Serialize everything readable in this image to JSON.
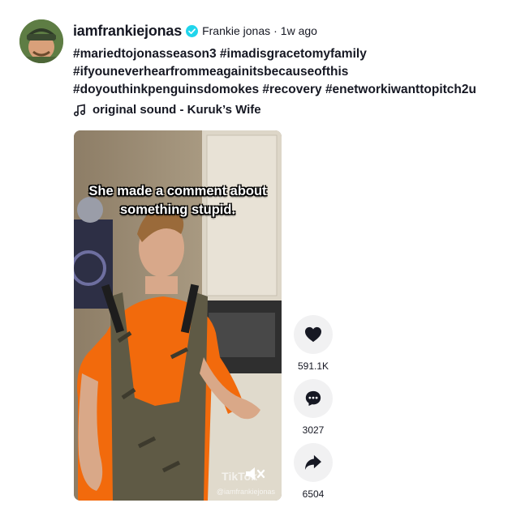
{
  "post": {
    "username": "iamfrankiejonas",
    "nickname": "Frankie jonas",
    "separator": "·",
    "time": "1w ago",
    "hashtags": [
      "#mariedtojonasseason3 #imadisgracetomyfamily",
      "#ifyouneverhearfrommeagainitsbecauseofthis",
      "#doyouthinkpenguinsdomokes #recovery #enetworkiwanttopitch2u"
    ],
    "sound": "original sound - Kuruk’s Wife"
  },
  "video": {
    "overlay_line1": "She made a comment about",
    "overlay_line2": "something stupid.",
    "watermark_logo": "TikTok",
    "watermark_handle": "@iamfrankiejonas"
  },
  "actions": {
    "likes": "591.1K",
    "comments": "3027",
    "shares": "6504"
  },
  "colors": {
    "verified": "#20d5ec",
    "button_bg": "#f1f1f2",
    "text": "#161823",
    "shirt": "#f26a0c"
  }
}
